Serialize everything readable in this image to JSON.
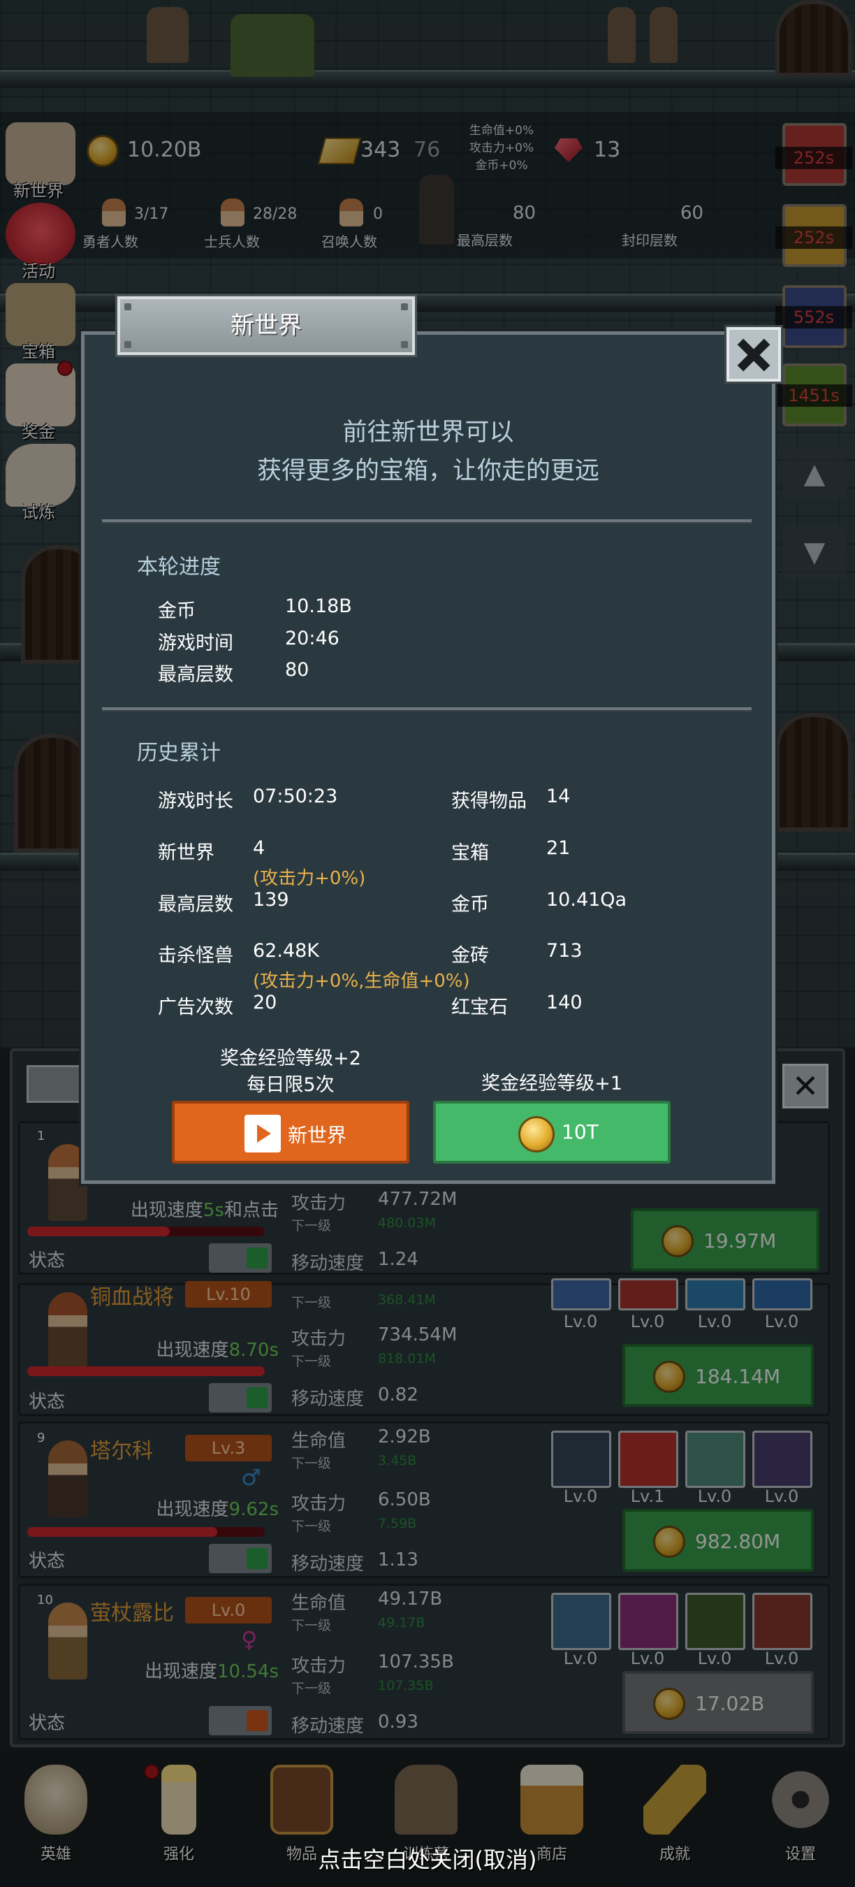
{
  "hud": {
    "coins": "10.20B",
    "gold_bars": "343",
    "gold_bars_extra": "76",
    "buffs": [
      "生命值+0%",
      "攻击力+0%",
      "金币+0%"
    ],
    "rubies": "13",
    "hero_count_value": "3/17",
    "hero_count_label": "勇者人数",
    "soldier_count_value": "28/28",
    "soldier_count_label": "士兵人数",
    "summon_count_value": "0",
    "summon_count_label": "召唤人数",
    "max_floor_value": "80",
    "max_floor_label": "最高层数",
    "seal_floor_value": "60",
    "seal_floor_label": "封印层数"
  },
  "side_menu": [
    "新世界",
    "活动",
    "宝箱",
    "奖金",
    "试炼"
  ],
  "timers": [
    "252s",
    "252s",
    "552s",
    "1451s"
  ],
  "dialog": {
    "title": "新世界",
    "subtitle_line1": "前往新世界可以",
    "subtitle_line2": "获得更多的宝箱，让你走的更远",
    "current": {
      "title": "本轮进度",
      "rows": [
        {
          "label": "金币",
          "value": "10.18B"
        },
        {
          "label": "游戏时间",
          "value": "20:46"
        },
        {
          "label": "最高层数",
          "value": "80"
        }
      ]
    },
    "history": {
      "title": "历史累计",
      "left": [
        {
          "label": "游戏时长",
          "value": "07:50:23"
        },
        {
          "label": "新世界",
          "value": "4"
        },
        {
          "label": "最高层数",
          "value": "139"
        },
        {
          "label": "击杀怪兽",
          "value": "62.48K"
        },
        {
          "label": "广告次数",
          "value": "20"
        }
      ],
      "right": [
        {
          "label": "获得物品",
          "value": "14"
        },
        {
          "label": "宝箱",
          "value": "21"
        },
        {
          "label": "金币",
          "value": "10.41Qa"
        },
        {
          "label": "金砖",
          "value": "713"
        },
        {
          "label": "红宝石",
          "value": "140"
        }
      ],
      "bonus_new_world": "(攻击力+0%)",
      "bonus_kills": "(攻击力+0%,生命值+0%)"
    },
    "ad_note_line1": "奖金经验等级+2",
    "ad_note_line2": "每日限5次",
    "gold_note": "奖金经验等级+1",
    "ad_button_label": "新世界",
    "gold_button_label": "10T"
  },
  "heroes": [
    {
      "index": "1",
      "appear_prefix": "出现速度",
      "appear_value": "5s",
      "appear_suffix": "和点击",
      "hp_fill": 0.6,
      "state_label": "状态",
      "attack_label": "攻击力",
      "attack": "477.72M",
      "attack_next_label": "下一级",
      "attack_next": "480.03M",
      "speed_label": "移动速度",
      "speed": "1.24",
      "upgrade": "19.97M",
      "toggle_color": "#2fa04a"
    },
    {
      "name": "铜血战将",
      "level": "Lv.10",
      "appear_prefix": "出现速度",
      "appear_value": "8.70s",
      "hp_fill": 1.0,
      "state_label": "状态",
      "hp_next_label": "下一级",
      "hp_next": "368.41M",
      "attack_label": "攻击力",
      "attack": "734.54M",
      "attack_next_label": "下一级",
      "attack_next": "818.01M",
      "speed_label": "移动速度",
      "speed": "0.82",
      "upgrade": "184.14M",
      "skills": [
        "Lv.0",
        "Lv.0",
        "Lv.0",
        "Lv.0"
      ],
      "toggle_color": "#2fa04a"
    },
    {
      "index": "9",
      "name": "塔尔科",
      "level": "Lv.3",
      "appear_prefix": "出现速度",
      "appear_value": "9.62s",
      "hp_fill": 0.8,
      "state_label": "状态",
      "hp_label": "生命值",
      "hp": "2.92B",
      "hp_next_label": "下一级",
      "hp_next": "3.45B",
      "attack_label": "攻击力",
      "attack": "6.50B",
      "attack_next_label": "下一级",
      "attack_next": "7.59B",
      "speed_label": "移动速度",
      "speed": "1.13",
      "upgrade": "982.80M",
      "skills": [
        "Lv.0",
        "Lv.1",
        "Lv.0",
        "Lv.0"
      ],
      "toggle_color": "#2fa04a"
    },
    {
      "index": "10",
      "name": "萤杖露比",
      "level": "Lv.0",
      "appear_prefix": "出现速度",
      "appear_value": "10.54s",
      "state_label": "状态",
      "hp_label": "生命值",
      "hp": "49.17B",
      "hp_next_label": "下一级",
      "hp_next": "49.17B",
      "attack_label": "攻击力",
      "attack": "107.35B",
      "attack_next_label": "下一级",
      "attack_next": "107.35B",
      "speed_label": "移动速度",
      "speed": "0.93",
      "upgrade": "17.02B",
      "skills": [
        "Lv.0",
        "Lv.0",
        "Lv.0",
        "Lv.0"
      ],
      "toggle_color": "#d2581c"
    }
  ],
  "nav": [
    "英雄",
    "强化",
    "物品",
    "训练营",
    "商店",
    "成就",
    "设置"
  ],
  "close_hint": "点击空白处关闭(取消)",
  "colors": {
    "accent_orange": "#e0661e",
    "accent_green": "#45b96a",
    "bonus_text": "#e8b34a",
    "timer_red": "#e04040"
  }
}
